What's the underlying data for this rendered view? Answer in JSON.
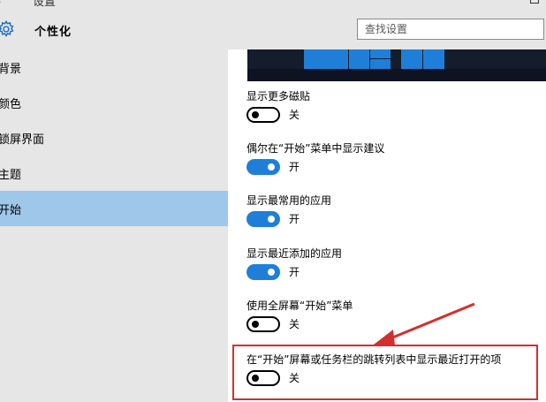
{
  "window": {
    "title": "设置",
    "back_glyph": "‹"
  },
  "header": {
    "title": "个性化",
    "search_placeholder": "查找设置"
  },
  "sidebar": {
    "items": [
      {
        "label": "背景",
        "active": false
      },
      {
        "label": "颜色",
        "active": false
      },
      {
        "label": "锁屏界面",
        "active": false
      },
      {
        "label": "主题",
        "active": false
      },
      {
        "label": "开始",
        "active": true
      }
    ]
  },
  "settings": [
    {
      "label": "显示更多磁贴",
      "on": false,
      "state": "关"
    },
    {
      "label": "偶尔在“开始”菜单中显示建议",
      "on": true,
      "state": "开"
    },
    {
      "label": "显示最常用的应用",
      "on": true,
      "state": "开"
    },
    {
      "label": "显示最近添加的应用",
      "on": true,
      "state": "开"
    },
    {
      "label": "使用全屏幕“开始”菜单",
      "on": false,
      "state": "关"
    },
    {
      "label": "在“开始”屏幕或任务栏的跳转列表中显示最近打开的项",
      "on": false,
      "state": "关"
    }
  ],
  "colors": {
    "accent": "#1f7fd8",
    "sidebar_bg": "#e6e6e6",
    "active_nav_bg": "#9ec7ea",
    "annotation": "#d32f2f"
  },
  "icons": {
    "gear": "gear-icon",
    "back": "back-arrow-icon",
    "annotation_arrow": "red-arrow-icon"
  }
}
